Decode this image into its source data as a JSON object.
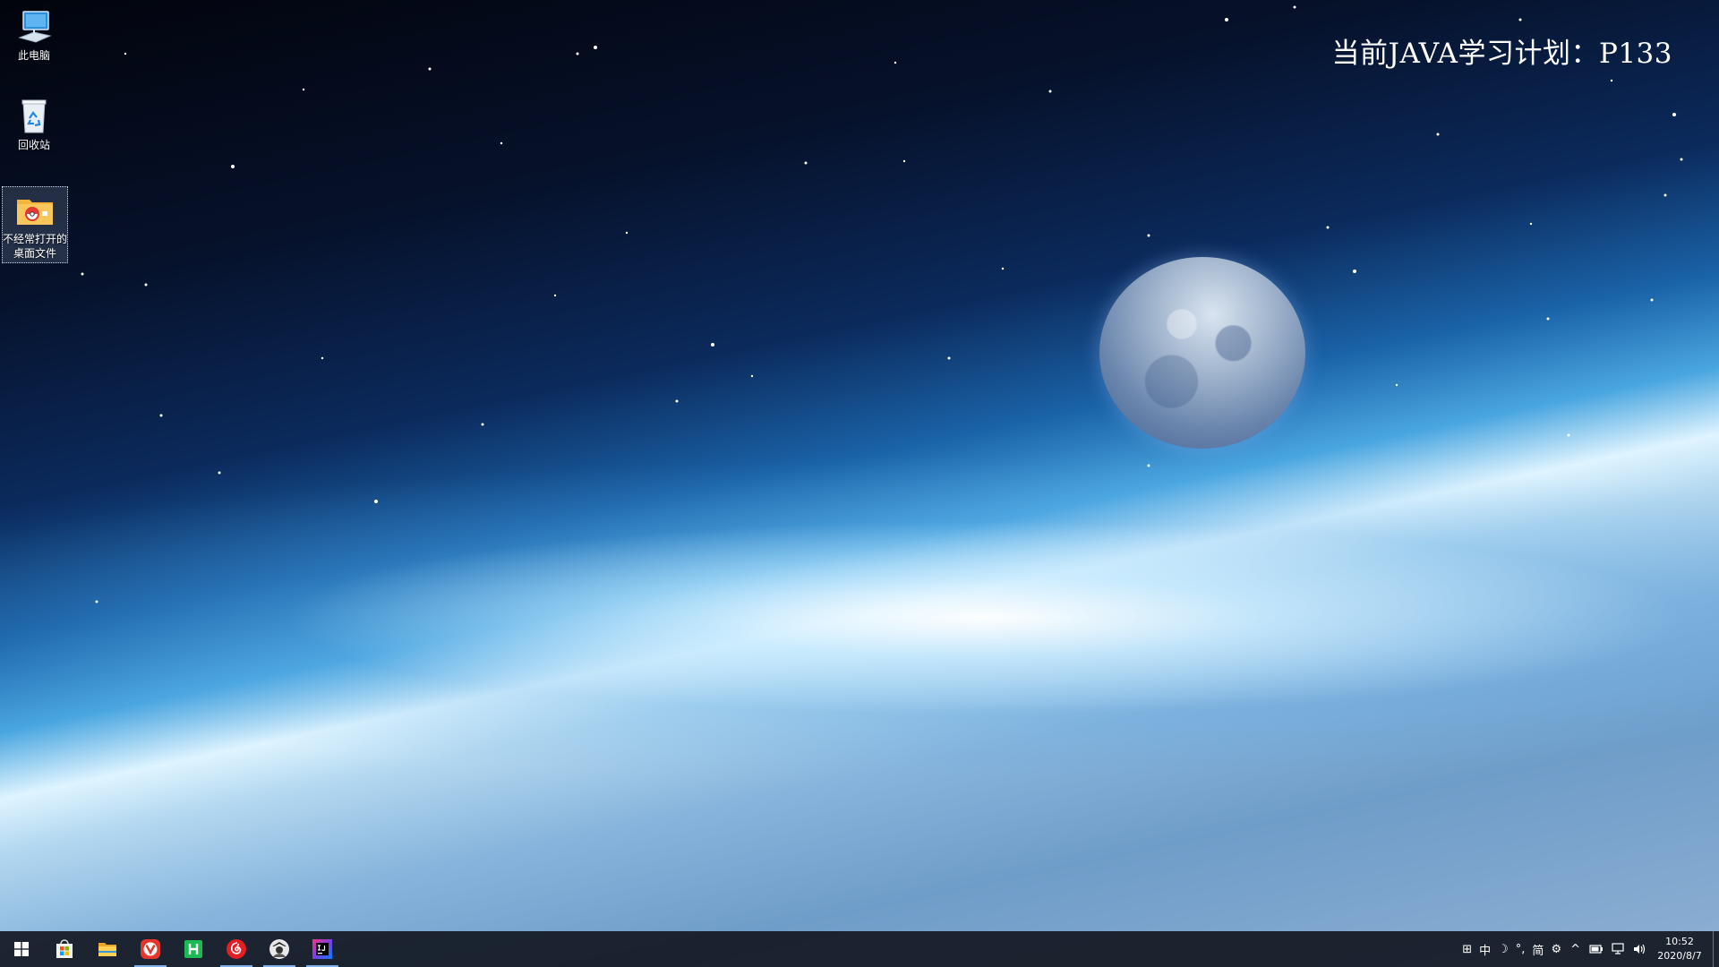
{
  "wallpaper": {
    "description_colors": {
      "space": "#04091a",
      "horizon_glow": "#dff4ff",
      "atmosphere": "#4aa6e0"
    }
  },
  "overlay_text": {
    "plan": "当前JAVA学习计划：P133"
  },
  "desktop_icons": [
    {
      "label": "此电脑",
      "icon": "computer-icon"
    },
    {
      "label": "回收站",
      "icon": "recycle-bin-icon"
    },
    {
      "label_line1": "不经常打开的",
      "label_line2": "桌面文件",
      "icon": "folder-icon",
      "selected": true
    }
  ],
  "taskbar": {
    "pinned": [
      {
        "name": "start-button",
        "icon": "windows-icon",
        "running": false
      },
      {
        "name": "store-button",
        "icon": "microsoft-store-icon",
        "running": false
      },
      {
        "name": "file-explorer-button",
        "icon": "folder-icon",
        "running": false
      },
      {
        "name": "vivaldi-button",
        "icon": "vivaldi-icon",
        "running": true
      },
      {
        "name": "hbuilder-button",
        "icon": "hbuilder-icon",
        "running": false
      },
      {
        "name": "netease-music-button",
        "icon": "netease-music-icon",
        "running": true
      },
      {
        "name": "app-avatar-button",
        "icon": "avatar-app-icon",
        "running": true
      },
      {
        "name": "intellij-button",
        "icon": "intellij-idea-icon",
        "running": true
      }
    ],
    "tray": {
      "ime_grid": "⊞",
      "ime_lang": "中",
      "ime_moon": "☽",
      "ime_punct": "°,",
      "ime_simplified": "简",
      "ime_settings": "⚙",
      "chevron": "^",
      "time": "10:52",
      "date": "2020/8/7"
    }
  }
}
